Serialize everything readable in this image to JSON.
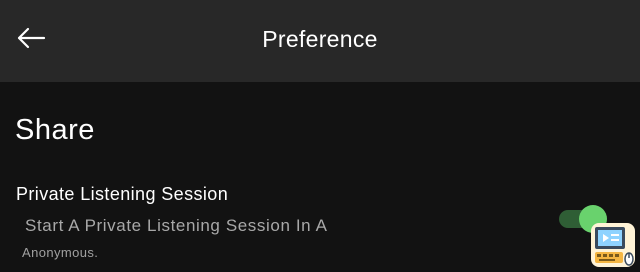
{
  "header": {
    "back_icon": "arrow-left-icon",
    "title": "Preference"
  },
  "section": {
    "title": "Share"
  },
  "setting": {
    "title": "Private Listening Session",
    "description": "Start A Private Listening Session In A",
    "description_continued": "Anonymous.",
    "toggle_on": true
  },
  "colors": {
    "header_bg": "#282828",
    "page_bg": "#121212",
    "toggle_track": "#2f5e35",
    "toggle_thumb": "#69d26d"
  },
  "watermark_icon": "computer-logo-icon"
}
